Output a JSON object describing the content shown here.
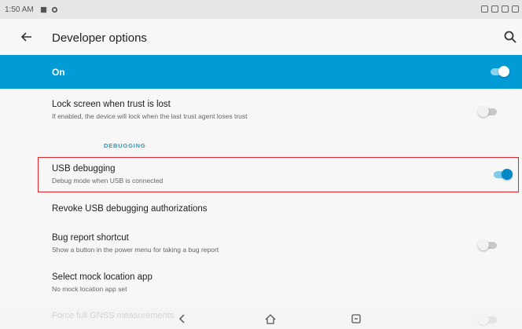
{
  "status_bar": {
    "time": "1:50 AM"
  },
  "app_bar": {
    "title": "Developer options"
  },
  "master_switch": {
    "label": "On",
    "state": "on"
  },
  "settings": {
    "lock_screen": {
      "title": "Lock screen when trust is lost",
      "summary": "If enabled, the device will lock when the last trust agent loses trust",
      "state": "off"
    },
    "section_debugging": "DEBUGGING",
    "usb_debugging": {
      "title": "USB debugging",
      "summary": "Debug mode when USB is connected",
      "state": "on"
    },
    "revoke_usb": {
      "title": "Revoke USB debugging authorizations"
    },
    "bug_report": {
      "title": "Bug report shortcut",
      "summary": "Show a button in the power menu for taking a bug report",
      "state": "off"
    },
    "mock_location": {
      "title": "Select mock location app",
      "summary": "No mock location app set"
    },
    "gnss": {
      "title": "Force full GNSS measurements"
    }
  },
  "colors": {
    "accent": "#029bd6",
    "highlight_border": "#e3242b"
  },
  "icons": [
    "back-arrow-icon",
    "search-icon",
    "nav-back-icon",
    "nav-home-icon",
    "nav-recents-icon"
  ]
}
